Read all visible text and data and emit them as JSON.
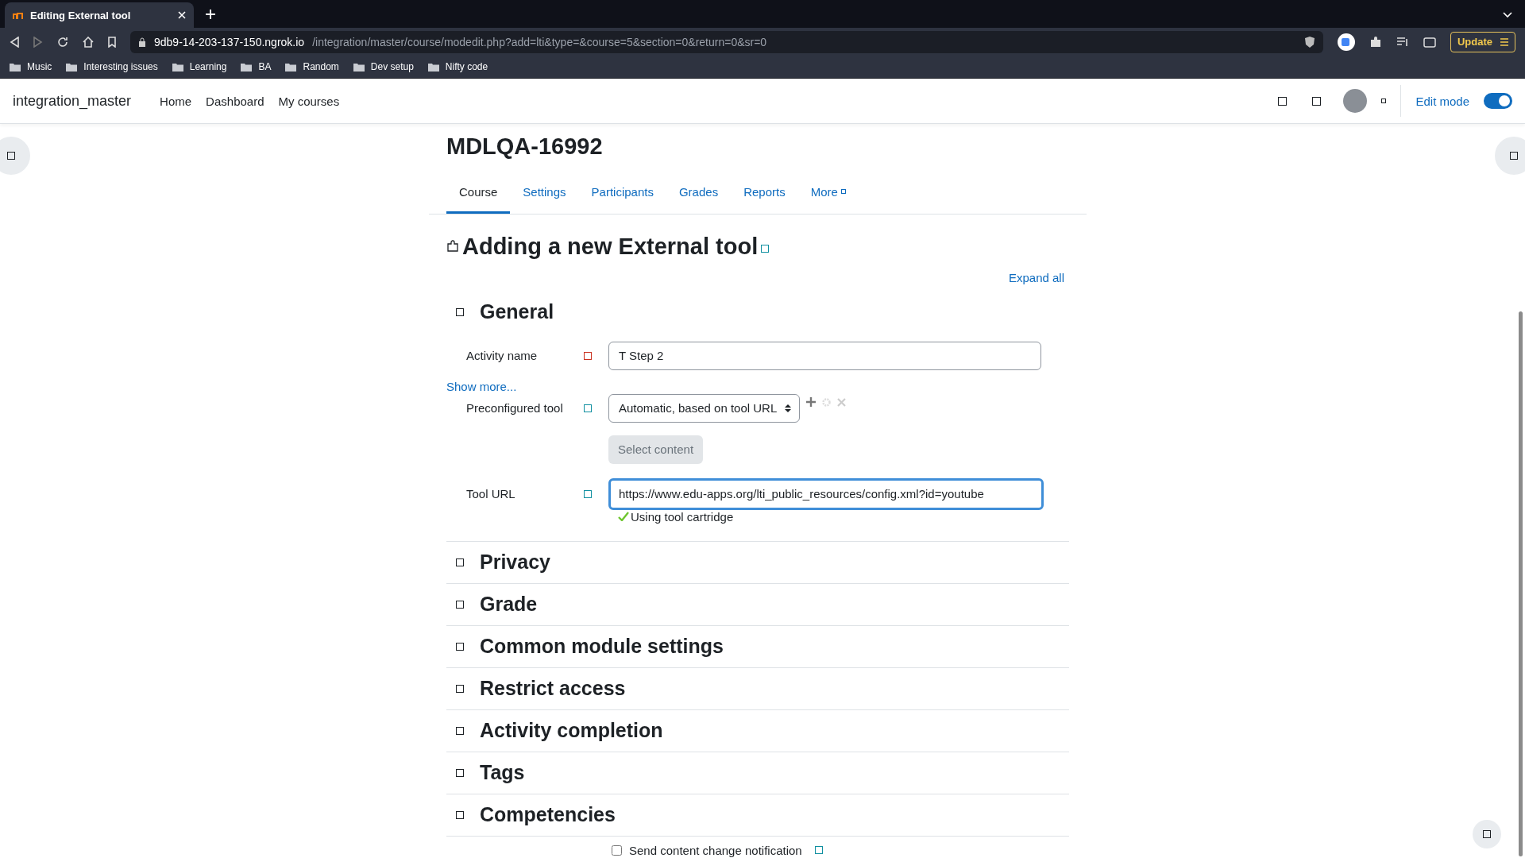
{
  "browser": {
    "tab_title": "Editing External tool",
    "url_host": "9db9-14-203-137-150.ngrok.io",
    "url_path": "/integration/master/course/modedit.php?add=lti&type=&course=5&section=0&return=0&sr=0",
    "update_button": "Update",
    "bookmarks": [
      "Music",
      "Interesting issues",
      "Learning",
      "BA",
      "Random",
      "Dev setup",
      "Nifty code"
    ]
  },
  "site": {
    "name": "integration_master",
    "nav": [
      "Home",
      "Dashboard",
      "My courses"
    ],
    "edit_mode": {
      "label": "Edit mode",
      "on": true
    }
  },
  "course": {
    "title": "MDLQA-16992",
    "tabs": [
      {
        "label": "Course",
        "selected": true
      },
      {
        "label": "Settings",
        "selected": false
      },
      {
        "label": "Participants",
        "selected": false
      },
      {
        "label": "Grades",
        "selected": false
      },
      {
        "label": "Reports",
        "selected": false
      },
      {
        "label": "More",
        "selected": false
      }
    ]
  },
  "page": {
    "heading": "Adding a new External tool",
    "expand_all": "Expand all",
    "general": {
      "title": "General",
      "activity_name": {
        "label": "Activity name",
        "value": "T Step 2"
      },
      "show_more": "Show more...",
      "preconfigured_tool": {
        "label": "Preconfigured tool",
        "value": "Automatic, based on tool URL"
      },
      "select_content": {
        "label": "Select content",
        "disabled": true
      },
      "tool_url": {
        "label": "Tool URL",
        "value": "https://www.edu-apps.org/lti_public_resources/config.xml?id=youtube",
        "focused": true,
        "status": "Using tool cartridge"
      }
    },
    "sections": [
      "Privacy",
      "Grade",
      "Common module settings",
      "Restrict access",
      "Activity completion",
      "Tags",
      "Competencies"
    ],
    "send_notification": {
      "label": "Send content change notification",
      "checked": false
    }
  }
}
